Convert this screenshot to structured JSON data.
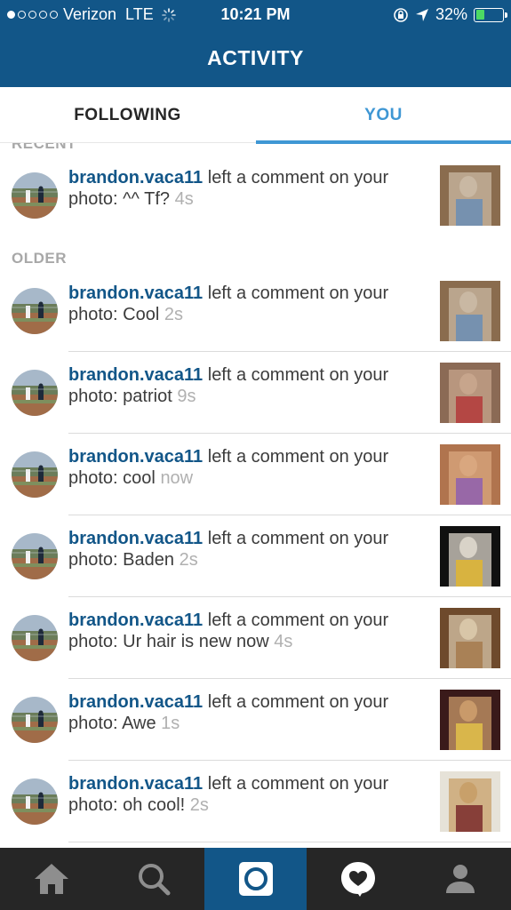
{
  "status_bar": {
    "carrier": "Verizon",
    "network": "LTE",
    "time": "10:21 PM",
    "battery": "32%",
    "signal_dots_filled": 1,
    "signal_dots_total": 5,
    "battery_level": 0.32
  },
  "header": {
    "title": "ACTIVITY"
  },
  "tabs": [
    {
      "label": "FOLLOWING",
      "active": false
    },
    {
      "label": "YOU",
      "active": true
    }
  ],
  "sections": {
    "recent": "RECENT",
    "older": "OLDER"
  },
  "recent": [
    {
      "user": "brandon.vaca11",
      "action": " left a comment on your photo: ",
      "comment": "^^ Tf?",
      "time": "4s",
      "thumb_colors": [
        "#8a6c4e",
        "#c9b8a3",
        "#6a8db5"
      ]
    }
  ],
  "older": [
    {
      "user": "brandon.vaca11",
      "action": " left a comment on your photo: ",
      "comment": "Cool",
      "time": "2s",
      "thumb_colors": [
        "#8a6c4e",
        "#c9b8a3",
        "#6a8db5"
      ]
    },
    {
      "user": "brandon.vaca11",
      "action": " left a comment on your photo: ",
      "comment": "patriot",
      "time": "9s",
      "thumb_colors": [
        "#8b6a55",
        "#c7a58c",
        "#b33a3a"
      ]
    },
    {
      "user": "brandon.vaca11",
      "action": " left a comment on your photo: ",
      "comment": "cool",
      "time": "now",
      "thumb_colors": [
        "#b0744e",
        "#d9a77f",
        "#8e5fb0"
      ]
    },
    {
      "user": "brandon.vaca11",
      "action": " left a comment on your photo: ",
      "comment": "Baden",
      "time": "2s",
      "thumb_colors": [
        "#101010",
        "#d9d3c8",
        "#e0b630"
      ]
    },
    {
      "user": "brandon.vaca11",
      "action": " left a comment on your photo: ",
      "comment": "Ur hair is new now",
      "time": "4s",
      "thumb_colors": [
        "#6e4a2c",
        "#d8c6a8",
        "#a67a4e"
      ]
    },
    {
      "user": "brandon.vaca11",
      "action": " left a comment on your photo: ",
      "comment": "Awe",
      "time": "1s",
      "thumb_colors": [
        "#3a1a1a",
        "#c99a6a",
        "#e2c14a"
      ]
    },
    {
      "user": "brandon.vaca11",
      "action": " left a comment on your photo: ",
      "comment": "oh cool!",
      "time": "2s",
      "thumb_colors": [
        "#e6e2d8",
        "#c8a06a",
        "#7a2b2b"
      ]
    }
  ],
  "tabbar": [
    {
      "name": "home-icon",
      "active": false
    },
    {
      "name": "search-icon",
      "active": false
    },
    {
      "name": "camera-icon",
      "active": true
    },
    {
      "name": "activity-heart-icon",
      "active": false
    },
    {
      "name": "profile-icon",
      "active": false
    }
  ],
  "colors": {
    "brand": "#125688",
    "accent": "#3f97d4",
    "tabbar_bg": "#262626",
    "battery": "#4cd964"
  }
}
